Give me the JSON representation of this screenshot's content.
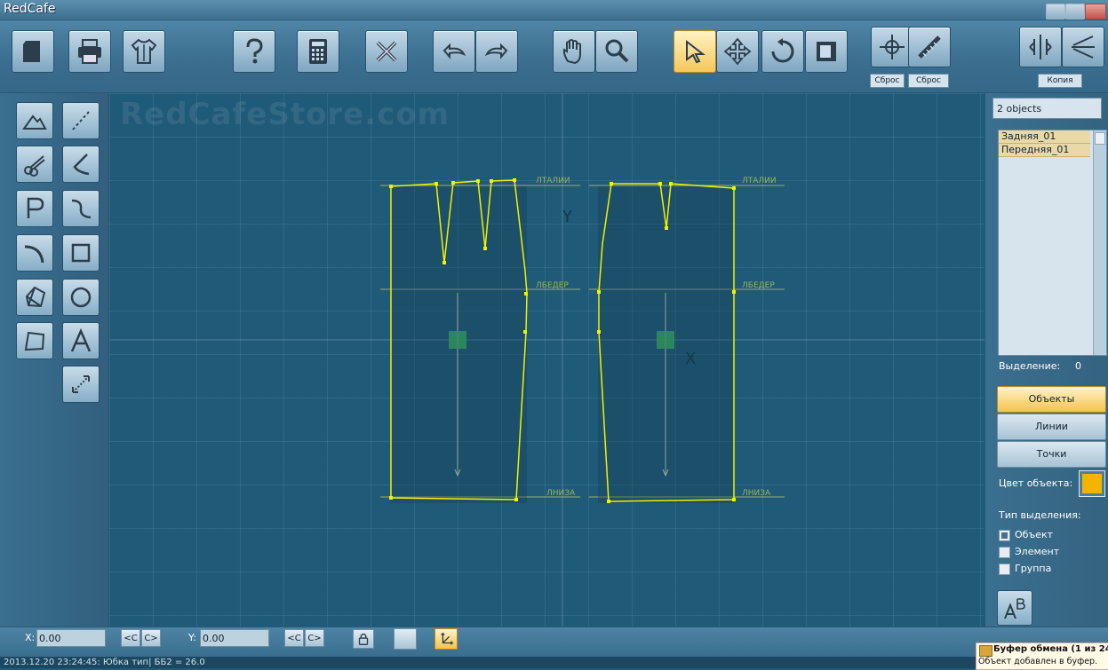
{
  "window": {
    "title": "RedCafe"
  },
  "toolbar": {
    "reset_label_1": "Сброс",
    "reset_label_2": "Сброс",
    "copy_label": "Копия"
  },
  "canvas": {
    "watermark": "RedCafeStore.com",
    "line_labels": {
      "waist_back": "ЛТАЛИИ",
      "waist_front": "ЛТАЛИИ",
      "hip_back": "ЛБЕДЕР",
      "hip_front": "ЛБЕДЕР",
      "hem_back": "ЛНИЗА",
      "hem_front": "ЛНИЗА"
    },
    "axis_y": "Y",
    "axis_x": "X",
    "pattern_color": "#f4f000"
  },
  "right_panel": {
    "object_count": "2 objects",
    "objects": [
      "Задняя_01",
      "Передняя_01"
    ],
    "selection_label": "Выделение:",
    "selection_value": "0",
    "modes": [
      "Объекты",
      "Линии",
      "Точки"
    ],
    "active_mode": "Объекты",
    "object_color_label": "Цвет объекта:",
    "object_color": "#f5b400",
    "selection_type_label": "Тип выделения:",
    "selection_types": [
      {
        "label": "Объект",
        "checked": true
      },
      {
        "label": "Элемент",
        "checked": false
      },
      {
        "label": "Группа",
        "checked": false
      }
    ]
  },
  "bottom": {
    "x_label": "X:",
    "x_value": "0.00",
    "y_label": "Y:",
    "y_value": "0.00",
    "prev_label": "<C",
    "next_label": "C>"
  },
  "status": {
    "text": "2013.12.20 23:24:45: Юбка тип| ББ2 = 26.0"
  },
  "notification": {
    "title": "Буфер обмена (1 из 24",
    "body": "Объект добавлен в буфер."
  }
}
